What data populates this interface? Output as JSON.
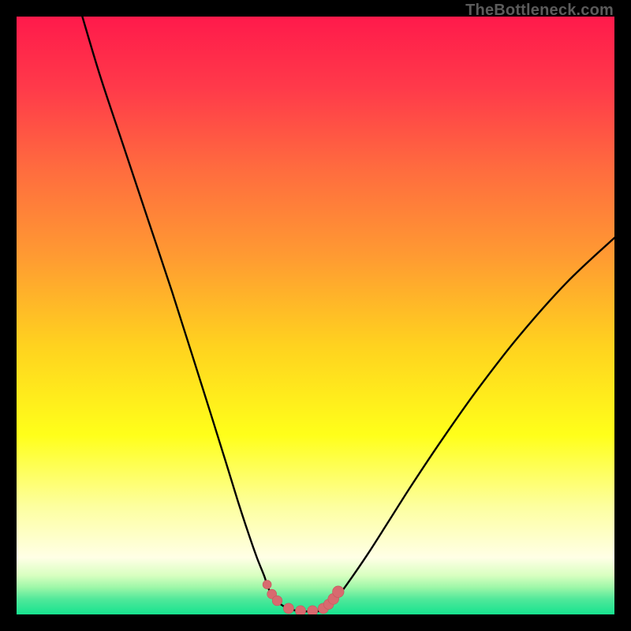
{
  "watermark": "TheBottleneck.com",
  "colors": {
    "frame": "#000000",
    "curve": "#000000",
    "marker_fill": "#d86a6f",
    "marker_stroke": "#c6575c",
    "gradient_stops": [
      {
        "offset": 0.0,
        "color": "#ff1a4b"
      },
      {
        "offset": 0.12,
        "color": "#ff3a4a"
      },
      {
        "offset": 0.25,
        "color": "#ff6a3f"
      },
      {
        "offset": 0.4,
        "color": "#ff9a32"
      },
      {
        "offset": 0.55,
        "color": "#ffd21f"
      },
      {
        "offset": 0.7,
        "color": "#ffff1a"
      },
      {
        "offset": 0.82,
        "color": "#fdffa0"
      },
      {
        "offset": 0.905,
        "color": "#ffffe6"
      },
      {
        "offset": 0.935,
        "color": "#d8ffc0"
      },
      {
        "offset": 0.955,
        "color": "#9cf7a8"
      },
      {
        "offset": 0.975,
        "color": "#4fe89a"
      },
      {
        "offset": 1.0,
        "color": "#17e38f"
      }
    ]
  },
  "chart_data": {
    "type": "line",
    "title": "",
    "xlabel": "",
    "ylabel": "",
    "xlim": [
      0,
      100
    ],
    "ylim": [
      0,
      100
    ],
    "grid": false,
    "series": [
      {
        "name": "bottleneck-curve",
        "x": [
          11,
          14,
          18,
          22,
          26,
          29.5,
          32.5,
          35,
          37,
          38.8,
          40.2,
          41.4,
          42.2,
          43.5,
          45,
          47,
          49,
          51,
          52.2,
          53,
          54.5,
          56.5,
          59,
          62,
          66,
          71,
          77,
          84,
          92,
          100
        ],
        "y": [
          100,
          90,
          78,
          66,
          54,
          43,
          33.5,
          25.5,
          19,
          13.5,
          9.5,
          6.5,
          4.2,
          2.3,
          1.2,
          0.6,
          0.5,
          0.6,
          1.2,
          2.2,
          4.0,
          6.8,
          10.5,
          15.2,
          21.5,
          29,
          37.5,
          46.5,
          55.5,
          63
        ]
      }
    ],
    "markers": {
      "name": "highlight-points",
      "x": [
        41.9,
        42.7,
        43.6,
        45.5,
        47.5,
        49.5,
        51.3,
        52.2,
        53.0,
        53.8
      ],
      "y": [
        5.0,
        3.4,
        2.3,
        1.0,
        0.6,
        0.6,
        1.0,
        1.7,
        2.6,
        3.8
      ],
      "r": [
        5.5,
        6.0,
        6.3,
        6.6,
        6.6,
        6.6,
        6.6,
        6.4,
        6.9,
        7.3
      ]
    }
  }
}
